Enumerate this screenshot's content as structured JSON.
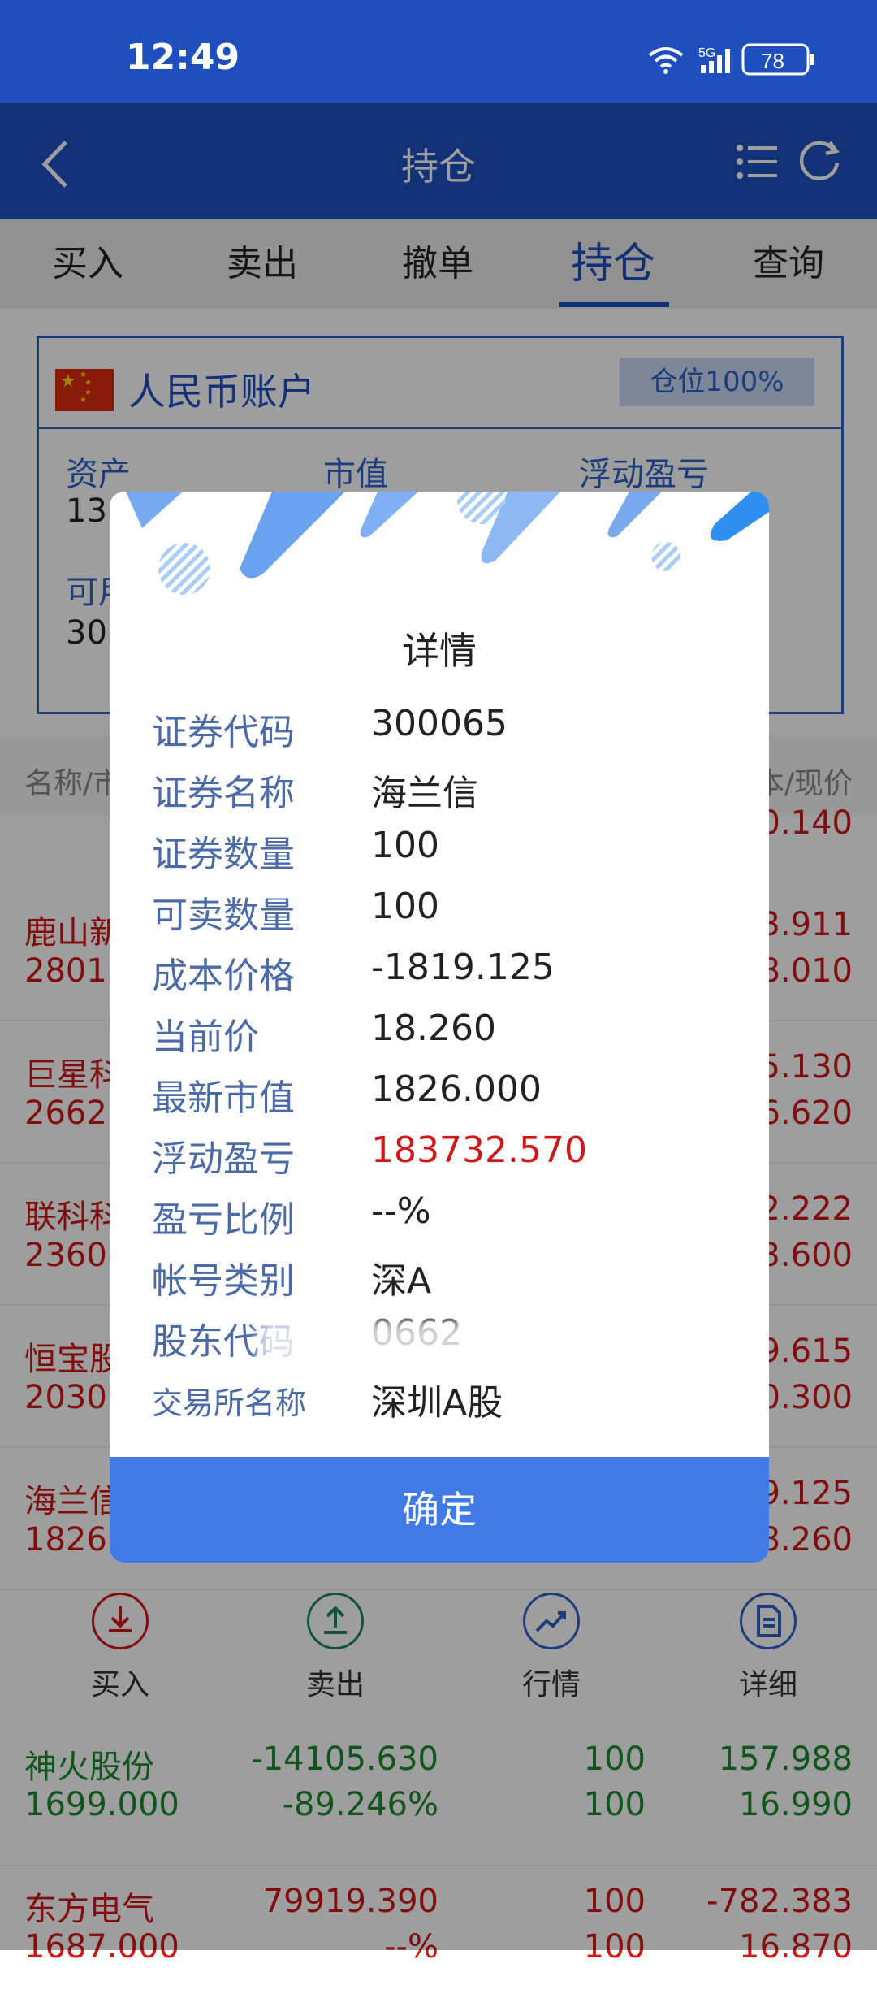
{
  "status_bar": {
    "time": "12:49",
    "network": "5G",
    "battery": "78"
  },
  "nav": {
    "title": "持仓"
  },
  "tabs": [
    {
      "label": "买入",
      "active": false
    },
    {
      "label": "卖出",
      "active": false
    },
    {
      "label": "撤单",
      "active": false
    },
    {
      "label": "持仓",
      "active": true
    },
    {
      "label": "查询",
      "active": false
    }
  ],
  "account": {
    "name": "人民币账户",
    "position_badge": "仓位100%",
    "labels": {
      "assets": "资产",
      "market_value": "市值",
      "floating_pnl": "浮动盈亏",
      "available": "可用"
    },
    "assets_partial": "13",
    "available_partial": "30"
  },
  "table_header": {
    "left": "名称/市",
    "right": "本/现价"
  },
  "holdings": [
    {
      "name": "鹿山新",
      "price": "2801.",
      "v3": "3.911",
      "v4": "8.010"
    },
    {
      "name": "巨星科",
      "price": "2662.",
      "v3": "5.130",
      "v4": "6.620"
    },
    {
      "name": "联科科",
      "price": "2360.",
      "v3": "2.222",
      "v4": "3.600"
    },
    {
      "name": "恒宝股",
      "price": "2030.",
      "v3": "9.615",
      "v4": "0.300"
    },
    {
      "name": "海兰信",
      "price": "1826.",
      "v3": "9.125",
      "v4": "8.260"
    }
  ],
  "partial_row_value": "0.140",
  "actions": [
    {
      "label": "买入",
      "icon": "download-icon"
    },
    {
      "label": "卖出",
      "icon": "upload-icon"
    },
    {
      "label": "行情",
      "icon": "trend-icon"
    },
    {
      "label": "详细",
      "icon": "document-icon"
    }
  ],
  "more_holdings": [
    {
      "name": "神火股份",
      "price": "1699.000",
      "pnl": "-14105.630",
      "pnl_ratio": "-89.246%",
      "qty": "100",
      "avail": "100",
      "cost": "157.988",
      "cur": "16.990",
      "color": "#1a8a2e"
    },
    {
      "name": "东方电气",
      "price": "1687.000",
      "pnl": "79919.390",
      "pnl_ratio": "--%",
      "qty": "100",
      "avail": "100",
      "cost": "-782.383",
      "cur": "16.870",
      "color": "#d01818"
    }
  ],
  "dialog": {
    "title": "详情",
    "rows": [
      {
        "key": "证券代码",
        "value": "300065"
      },
      {
        "key": "证券名称",
        "value": "海兰信"
      },
      {
        "key": "证券数量",
        "value": "100"
      },
      {
        "key": "可卖数量",
        "value": "100"
      },
      {
        "key": "成本价格",
        "value": "-1819.125"
      },
      {
        "key": "当前价",
        "value": "18.260"
      },
      {
        "key": "最新市值",
        "value": "1826.000"
      },
      {
        "key": "浮动盈亏",
        "value": "183732.570"
      },
      {
        "key": "盈亏比例",
        "value": "--%"
      },
      {
        "key": "帐号类别",
        "value": "深A"
      },
      {
        "key": "股东代码",
        "value": "0662"
      },
      {
        "key": "交易所名称",
        "value": "深圳A股"
      }
    ],
    "confirm_label": "确定"
  },
  "colors": {
    "primary": "#1f4fbf",
    "confirm": "#3f7ae6",
    "loss": "#1a8a2e",
    "gain": "#d01818"
  }
}
